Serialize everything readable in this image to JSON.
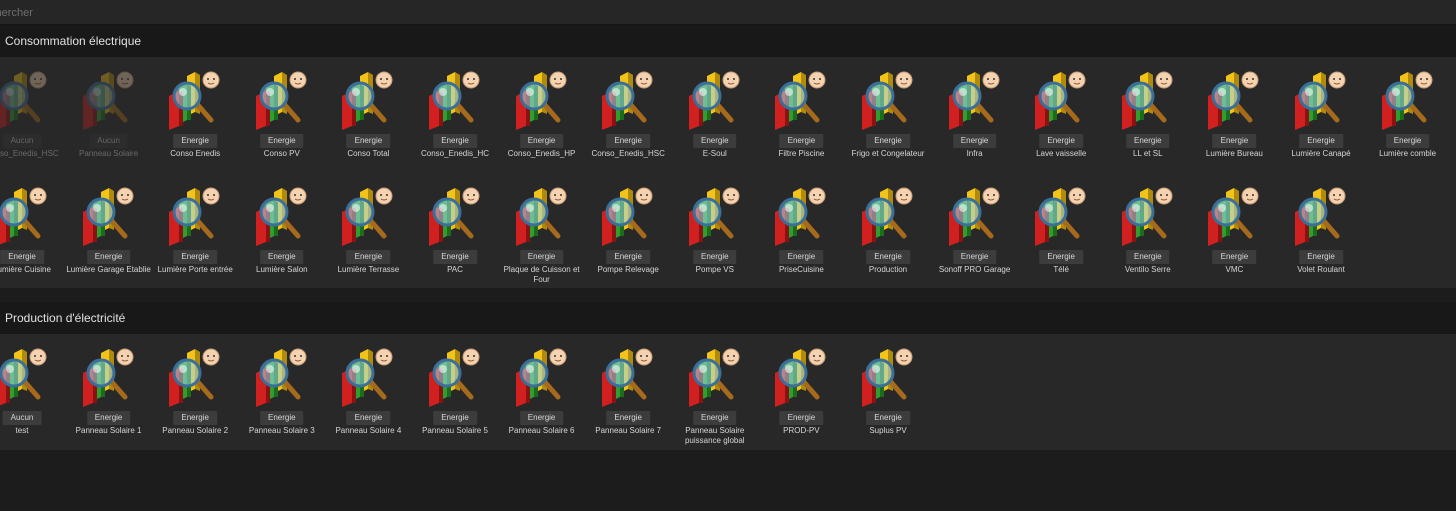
{
  "search": {
    "placeholder": "Rechercher"
  },
  "sections": [
    {
      "title": "Consommation électrique",
      "items": [
        {
          "tag": "Aucun",
          "label": "Conso_Enedis_HSC",
          "disabled": true
        },
        {
          "tag": "Aucun",
          "label": "Panneau Solaire",
          "disabled": true
        },
        {
          "tag": "Energie",
          "label": "Conso Enedis"
        },
        {
          "tag": "Energie",
          "label": "Conso PV"
        },
        {
          "tag": "Energie",
          "label": "Conso Total"
        },
        {
          "tag": "Energie",
          "label": "Conso_Enedis_HC"
        },
        {
          "tag": "Energie",
          "label": "Conso_Enedis_HP"
        },
        {
          "tag": "Energie",
          "label": "Conso_Enedis_HSC"
        },
        {
          "tag": "Energie",
          "label": "E-Soul"
        },
        {
          "tag": "Energie",
          "label": "Filtre Piscine"
        },
        {
          "tag": "Energie",
          "label": "Frigo et Congelateur"
        },
        {
          "tag": "Energie",
          "label": "Infra"
        },
        {
          "tag": "Energie",
          "label": "Lave vaisselle"
        },
        {
          "tag": "Energie",
          "label": "LL et SL"
        },
        {
          "tag": "Energie",
          "label": "Lumière Bureau"
        },
        {
          "tag": "Energie",
          "label": "Lumière Canapé"
        },
        {
          "tag": "Energie",
          "label": "Lumière comble"
        },
        {
          "tag": "Energie",
          "label": "Lumière Cuisine"
        },
        {
          "tag": "Energie",
          "label": "Lumière Garage Etablie"
        },
        {
          "tag": "Energie",
          "label": "Lumière Porte entrée"
        },
        {
          "tag": "Energie",
          "label": "Lumière Salon"
        },
        {
          "tag": "Energie",
          "label": "Lumière Terrasse"
        },
        {
          "tag": "Energie",
          "label": "PAC"
        },
        {
          "tag": "Energie",
          "label": "Plaque de Cuisson et Four"
        },
        {
          "tag": "Energie",
          "label": "Pompe Relevage"
        },
        {
          "tag": "Energie",
          "label": "Pompe VS"
        },
        {
          "tag": "Energie",
          "label": "PriseCuisine"
        },
        {
          "tag": "Energie",
          "label": "Production"
        },
        {
          "tag": "Energie",
          "label": "Sonoff PRO Garage"
        },
        {
          "tag": "Energie",
          "label": "Télé"
        },
        {
          "tag": "Energie",
          "label": "Ventilo Serre"
        },
        {
          "tag": "Energie",
          "label": "VMC"
        },
        {
          "tag": "Energie",
          "label": "Volet Roulant"
        }
      ]
    },
    {
      "title": "Production d'électricité",
      "items": [
        {
          "tag": "Aucun",
          "label": "test"
        },
        {
          "tag": "Energie",
          "label": "Panneau Solaire 1"
        },
        {
          "tag": "Energie",
          "label": "Panneau Solaire 2"
        },
        {
          "tag": "Energie",
          "label": "Panneau Solaire 3"
        },
        {
          "tag": "Energie",
          "label": "Panneau Solaire 4"
        },
        {
          "tag": "Energie",
          "label": "Panneau Solaire 5"
        },
        {
          "tag": "Energie",
          "label": "Panneau Solaire 6"
        },
        {
          "tag": "Energie",
          "label": "Panneau Solaire 7"
        },
        {
          "tag": "Energie",
          "label": "Panneau Solaire puissance global"
        },
        {
          "tag": "Energie",
          "label": "PROD-PV"
        },
        {
          "tag": "Energie",
          "label": "Suplus PV"
        }
      ]
    }
  ],
  "icon": {
    "name": "energy-chart-magnifier-icon"
  },
  "colors": {
    "background": "#1c1c1c",
    "panel": "#282828",
    "tag": "#3c3c3c",
    "bar_red": "#d0201f",
    "bar_green": "#2f9e2f",
    "bar_yellow": "#f2c318"
  }
}
